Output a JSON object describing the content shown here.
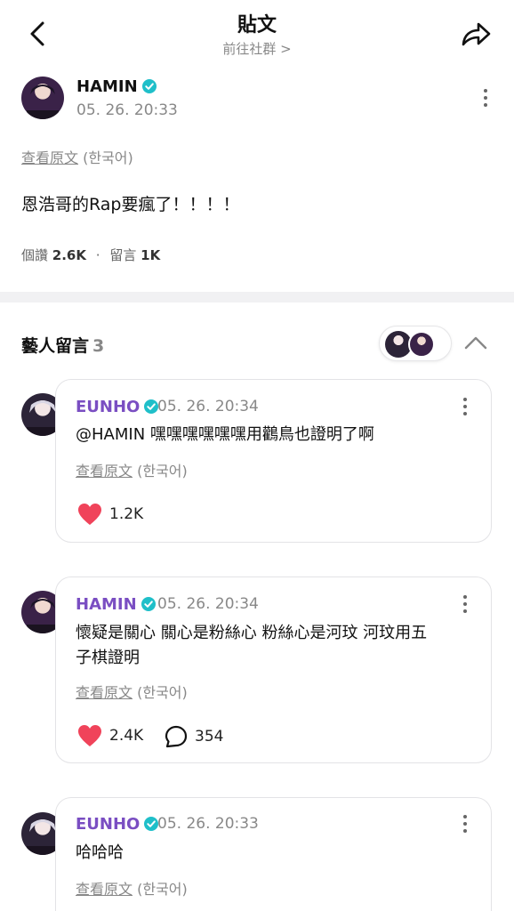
{
  "header": {
    "title": "貼文",
    "community_link": "前往社群 >"
  },
  "post": {
    "author": "HAMIN",
    "date": "05. 26. 20:33",
    "translate_link": "查看原文",
    "translate_lang": "(한국어)",
    "text": "恩浩哥的Rap要瘋了！！！！",
    "likes_label": "個讚",
    "likes": "2.6K",
    "separator": "·",
    "comments_label": "留言",
    "comments": "1K"
  },
  "artist_comments": {
    "title": "藝人留言",
    "count": "3",
    "items": [
      {
        "author": "EUNHO",
        "date": "05. 26. 20:34",
        "text": "@HAMIN 嘿嘿嘿嘿嘿嘿用鸛鳥也證明了啊",
        "translate_link": "查看原文",
        "translate_lang": "(한국어)",
        "likes": "1.2K"
      },
      {
        "author": "HAMIN",
        "date": "05. 26. 20:34",
        "text_line1": "懷疑是關心 關心是粉絲心 粉絲心是河玟 河玟用五",
        "text_line2": "子棋證明",
        "translate_link": "查看原文",
        "translate_lang": "(한국어)",
        "likes": "2.4K",
        "replies": "354"
      },
      {
        "author": "EUNHO",
        "date": "05. 26. 20:33",
        "text": "哈哈哈",
        "translate_link": "查看原文",
        "translate_lang": "(한국어)"
      }
    ]
  },
  "colors": {
    "accent_purple": "#7a4ec2",
    "verified_teal": "#1fbfc9",
    "heart_red": "#f0435a"
  },
  "icons": [
    "back-arrow-icon",
    "share-icon",
    "verified-icon",
    "more-vertical-icon",
    "heart-icon",
    "comment-bubble-icon",
    "chevron-up-icon"
  ]
}
